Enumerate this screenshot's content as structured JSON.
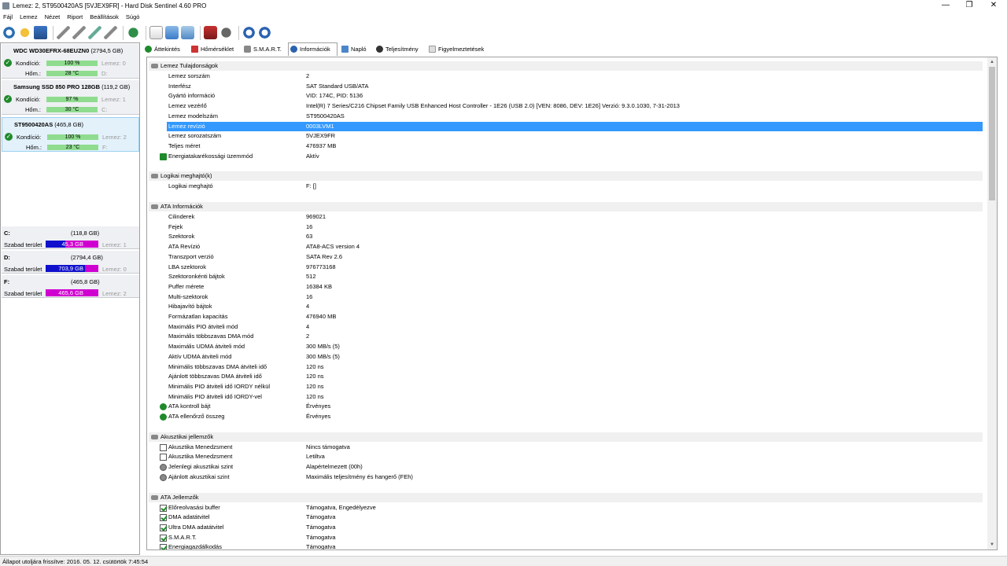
{
  "window": {
    "title": "Lemez: 2, ST9500420AS [5VJEX9FR]  -  Hard Disk Sentinel 4.60 PRO"
  },
  "menu": [
    "Fájl",
    "Lemez",
    "Nézet",
    "Riport",
    "Beállítások",
    "Súgó"
  ],
  "disks": [
    {
      "name": "WDC WD30EFRX-68EUZN0",
      "size": "(2794,5 GB)",
      "kondicio_label": "Kondíció:",
      "kondicio": "100 %",
      "kondicio_value": 100,
      "hom_label": "Hőm.:",
      "hom": "28 °C",
      "lemez": "Lemez: 0",
      "drive": "D:"
    },
    {
      "name": "Samsung SSD 850 PRO 128GB",
      "size": "(119,2 GB)",
      "kondicio_label": "Kondíció:",
      "kondicio": "97 %",
      "kondicio_value": 97,
      "hom_label": "Hőm.:",
      "hom": "30 °C",
      "lemez": "Lemez: 1",
      "drive": "C:"
    },
    {
      "name": "ST9500420AS",
      "size": "(465,8 GB)",
      "kondicio_label": "Kondíció:",
      "kondicio": "100 %",
      "kondicio_value": 100,
      "hom_label": "Hőm.:",
      "hom": "23 °C",
      "lemez": "Lemez: 2",
      "drive": "F:"
    }
  ],
  "volumes": [
    {
      "name": "C:",
      "size": "(118,8 GB)",
      "label": "Szabad terület",
      "free": "45,3 GB",
      "free_fraction": 0.38,
      "disk": "Lemez: 1"
    },
    {
      "name": "D:",
      "size": "(2794,4 GB)",
      "label": "Szabad terület",
      "free": "703,9 GB",
      "free_fraction": 0.75,
      "disk": "Lemez: 0"
    },
    {
      "name": "F:",
      "size": "(465,8 GB)",
      "label": "Szabad terület",
      "free": "465,6 GB",
      "free_fraction": 0.0,
      "disk": "Lemez: 2"
    }
  ],
  "tabs": [
    "Áttekintés",
    "Hőmérséklet",
    "S.M.A.R.T.",
    "Információk",
    "Napló",
    "Teljesítmény",
    "Figyelmeztetések"
  ],
  "active_tab": "Információk",
  "sections": [
    {
      "title": "Lemez Tulajdonságok",
      "rows": [
        {
          "k": "Lemez sorszám",
          "v": "2"
        },
        {
          "k": "Interfész",
          "v": "SAT Standard USB/ATA"
        },
        {
          "k": "Gyártó információ",
          "v": "VID: 174C, PID: 5136"
        },
        {
          "k": "Lemez vezérlő",
          "v": "Intel(R) 7 Series/C216 Chipset Family USB Enhanced Host Controller - 1E26 (USB 2.0) [VEN: 8086, DEV: 1E26] Verzió: 9.3.0.1030, 7-31-2013"
        },
        {
          "k": "Lemez modelszám",
          "v": "ST9500420AS"
        },
        {
          "k": "Lemez revízió",
          "v": "0003LVM1",
          "highlight": true
        },
        {
          "k": "Lemez sorozatszám",
          "v": "5VJEX9FR"
        },
        {
          "k": "Teljes méret",
          "v": "476937 MB"
        },
        {
          "k": "Energiatakarékossági üzemmód",
          "v": "Aktív",
          "icon": "arrow"
        }
      ]
    },
    {
      "title": "Logikai meghajtó(k)",
      "rows": [
        {
          "k": "Logikai meghajtó",
          "v": "F: []"
        }
      ]
    },
    {
      "title": "ATA Információk",
      "rows": [
        {
          "k": "Cilinderek",
          "v": "969021"
        },
        {
          "k": "Fejek",
          "v": "16"
        },
        {
          "k": "Szektorok",
          "v": "63"
        },
        {
          "k": "ATA Revízió",
          "v": "ATA8-ACS version 4"
        },
        {
          "k": "Transzport verzió",
          "v": "SATA Rev 2.6"
        },
        {
          "k": "LBA szektorok",
          "v": "976773168"
        },
        {
          "k": "Szektoronkénti bájtok",
          "v": "512"
        },
        {
          "k": "Puffer mérete",
          "v": "16384 KB"
        },
        {
          "k": "Multi-szektorok",
          "v": "16"
        },
        {
          "k": "Hibajavító bájtok",
          "v": "4"
        },
        {
          "k": "Formázatlan kapacitás",
          "v": "476940 MB"
        },
        {
          "k": "Maximális PIO átviteli mód",
          "v": "4"
        },
        {
          "k": "Maximális többszavas DMA mód",
          "v": "2"
        },
        {
          "k": "Maximális UDMA átviteli mód",
          "v": "300 MB/s (5)"
        },
        {
          "k": "Aktív UDMA átviteli mód",
          "v": "300 MB/s (5)"
        },
        {
          "k": "Minimális többszavas DMA átviteli idő",
          "v": "120 ns"
        },
        {
          "k": "Ajánlott többszavas DMA átviteli idő",
          "v": "120 ns"
        },
        {
          "k": "Minimális PIO átviteli idő IORDY nélkül",
          "v": "120 ns"
        },
        {
          "k": "Minimális PIO átviteli idő IORDY-vel",
          "v": "120 ns"
        },
        {
          "k": "ATA kontroll bájt",
          "v": "Érvényes",
          "icon": "ok"
        },
        {
          "k": "ATA ellenőrző összeg",
          "v": "Érvényes",
          "icon": "ok"
        }
      ]
    },
    {
      "title": "Akusztikai jellemzők",
      "rows": [
        {
          "k": "Akusztika Menedzsment",
          "v": "Nincs támogatva",
          "icon": "cb"
        },
        {
          "k": "Akusztika Menedzsment",
          "v": "Letiltva",
          "icon": "cb"
        },
        {
          "k": "Jelenlegi akusztikai szint",
          "v": "Alapértelmezett (00h)",
          "icon": "knob"
        },
        {
          "k": "Ajánlott akusztikai szint",
          "v": "Maximális teljesítmény és hangerő (FEh)",
          "icon": "knob"
        }
      ]
    },
    {
      "title": "ATA Jellemzők",
      "rows": [
        {
          "k": "Előreolvasási buffer",
          "v": "Támogatva, Engedélyezve",
          "icon": "cbc"
        },
        {
          "k": "DMA adatátvitel",
          "v": "Támogatva",
          "icon": "cbc"
        },
        {
          "k": "Ultra DMA adatátvitel",
          "v": "Támogatva",
          "icon": "cbc"
        },
        {
          "k": "S.M.A.R.T.",
          "v": "Támogatva",
          "icon": "cbc"
        },
        {
          "k": "Energiagazdálkodás",
          "v": "Támogatva",
          "icon": "cbc"
        }
      ]
    }
  ],
  "status": "Állapot utoljára frissítve: 2016. 05. 12. csütörtök 7:45:54",
  "colors": {
    "highlight": "#3399ff",
    "kondicio_bar": "#8fdc8f",
    "free_bar": "#1010cc",
    "used_bar": "#d000d0",
    "ok_green": "#1f8a2b"
  }
}
